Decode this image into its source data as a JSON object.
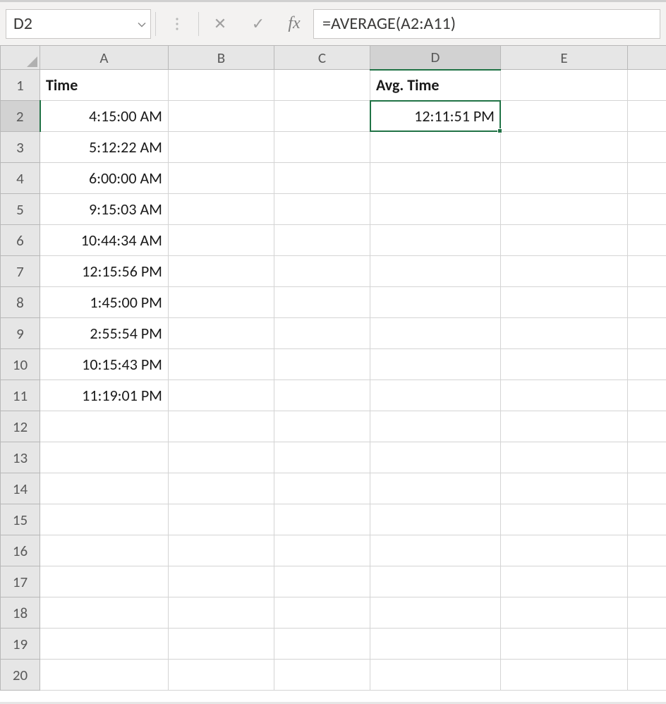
{
  "nameBox": {
    "value": "D2"
  },
  "formulaBar": {
    "cancel_icon": "✕",
    "enter_icon": "✓",
    "fx_label": "fx",
    "formula": "=AVERAGE(A2:A11)"
  },
  "columns": [
    "A",
    "B",
    "C",
    "D",
    "E",
    ""
  ],
  "rows": [
    1,
    2,
    3,
    4,
    5,
    6,
    7,
    8,
    9,
    10,
    11,
    12,
    13,
    14,
    15,
    16,
    17,
    18,
    19,
    20
  ],
  "selectedCell": {
    "col": "D",
    "row": 2
  },
  "cells": {
    "A1": {
      "text": "Time",
      "bold": true,
      "align": "left"
    },
    "D1": {
      "text": "Avg. Time",
      "bold": true,
      "align": "left"
    },
    "A2": {
      "text": "4:15:00 AM",
      "align": "right"
    },
    "A3": {
      "text": "5:12:22 AM",
      "align": "right"
    },
    "A4": {
      "text": "6:00:00 AM",
      "align": "right"
    },
    "A5": {
      "text": "9:15:03 AM",
      "align": "right"
    },
    "A6": {
      "text": "10:44:34 AM",
      "align": "right"
    },
    "A7": {
      "text": "12:15:56 PM",
      "align": "right"
    },
    "A8": {
      "text": "1:45:00 PM",
      "align": "right"
    },
    "A9": {
      "text": "2:55:54 PM",
      "align": "right"
    },
    "A10": {
      "text": "10:15:43 PM",
      "align": "right"
    },
    "A11": {
      "text": "11:19:01 PM",
      "align": "right"
    },
    "D2": {
      "text": "12:11:51 PM",
      "align": "right",
      "selected": true
    }
  }
}
